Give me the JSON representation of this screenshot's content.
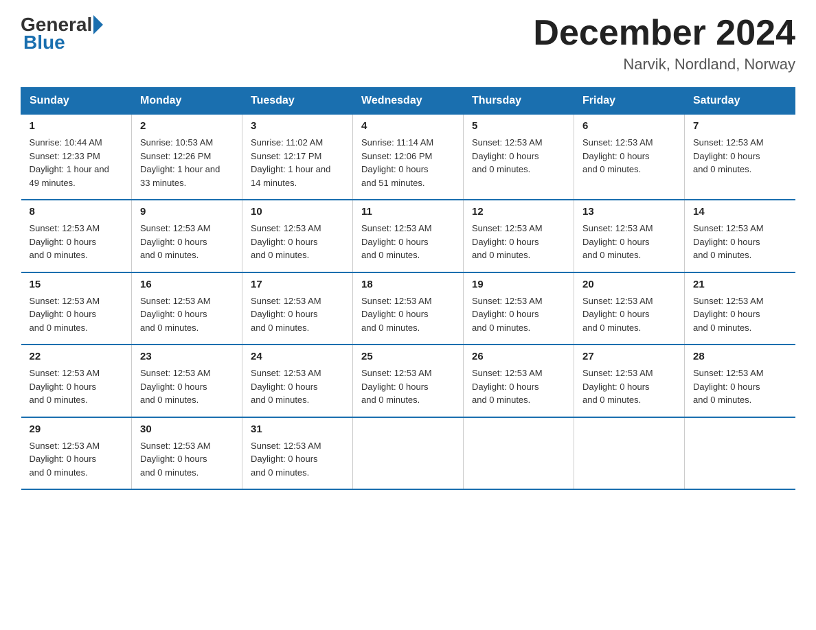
{
  "header": {
    "logo_general": "General",
    "logo_blue": "Blue",
    "month_title": "December 2024",
    "location": "Narvik, Nordland, Norway"
  },
  "days_of_week": [
    "Sunday",
    "Monday",
    "Tuesday",
    "Wednesday",
    "Thursday",
    "Friday",
    "Saturday"
  ],
  "weeks": [
    [
      {
        "day": "1",
        "info": "Sunrise: 10:44 AM\nSunset: 12:33 PM\nDaylight: 1 hour and\n49 minutes."
      },
      {
        "day": "2",
        "info": "Sunrise: 10:53 AM\nSunset: 12:26 PM\nDaylight: 1 hour and\n33 minutes."
      },
      {
        "day": "3",
        "info": "Sunrise: 11:02 AM\nSunset: 12:17 PM\nDaylight: 1 hour and\n14 minutes."
      },
      {
        "day": "4",
        "info": "Sunrise: 11:14 AM\nSunset: 12:06 PM\nDaylight: 0 hours\nand 51 minutes."
      },
      {
        "day": "5",
        "info": "Sunset: 12:53 AM\nDaylight: 0 hours\nand 0 minutes."
      },
      {
        "day": "6",
        "info": "Sunset: 12:53 AM\nDaylight: 0 hours\nand 0 minutes."
      },
      {
        "day": "7",
        "info": "Sunset: 12:53 AM\nDaylight: 0 hours\nand 0 minutes."
      }
    ],
    [
      {
        "day": "8",
        "info": "Sunset: 12:53 AM\nDaylight: 0 hours\nand 0 minutes."
      },
      {
        "day": "9",
        "info": "Sunset: 12:53 AM\nDaylight: 0 hours\nand 0 minutes."
      },
      {
        "day": "10",
        "info": "Sunset: 12:53 AM\nDaylight: 0 hours\nand 0 minutes."
      },
      {
        "day": "11",
        "info": "Sunset: 12:53 AM\nDaylight: 0 hours\nand 0 minutes."
      },
      {
        "day": "12",
        "info": "Sunset: 12:53 AM\nDaylight: 0 hours\nand 0 minutes."
      },
      {
        "day": "13",
        "info": "Sunset: 12:53 AM\nDaylight: 0 hours\nand 0 minutes."
      },
      {
        "day": "14",
        "info": "Sunset: 12:53 AM\nDaylight: 0 hours\nand 0 minutes."
      }
    ],
    [
      {
        "day": "15",
        "info": "Sunset: 12:53 AM\nDaylight: 0 hours\nand 0 minutes."
      },
      {
        "day": "16",
        "info": "Sunset: 12:53 AM\nDaylight: 0 hours\nand 0 minutes."
      },
      {
        "day": "17",
        "info": "Sunset: 12:53 AM\nDaylight: 0 hours\nand 0 minutes."
      },
      {
        "day": "18",
        "info": "Sunset: 12:53 AM\nDaylight: 0 hours\nand 0 minutes."
      },
      {
        "day": "19",
        "info": "Sunset: 12:53 AM\nDaylight: 0 hours\nand 0 minutes."
      },
      {
        "day": "20",
        "info": "Sunset: 12:53 AM\nDaylight: 0 hours\nand 0 minutes."
      },
      {
        "day": "21",
        "info": "Sunset: 12:53 AM\nDaylight: 0 hours\nand 0 minutes."
      }
    ],
    [
      {
        "day": "22",
        "info": "Sunset: 12:53 AM\nDaylight: 0 hours\nand 0 minutes."
      },
      {
        "day": "23",
        "info": "Sunset: 12:53 AM\nDaylight: 0 hours\nand 0 minutes."
      },
      {
        "day": "24",
        "info": "Sunset: 12:53 AM\nDaylight: 0 hours\nand 0 minutes."
      },
      {
        "day": "25",
        "info": "Sunset: 12:53 AM\nDaylight: 0 hours\nand 0 minutes."
      },
      {
        "day": "26",
        "info": "Sunset: 12:53 AM\nDaylight: 0 hours\nand 0 minutes."
      },
      {
        "day": "27",
        "info": "Sunset: 12:53 AM\nDaylight: 0 hours\nand 0 minutes."
      },
      {
        "day": "28",
        "info": "Sunset: 12:53 AM\nDaylight: 0 hours\nand 0 minutes."
      }
    ],
    [
      {
        "day": "29",
        "info": "Sunset: 12:53 AM\nDaylight: 0 hours\nand 0 minutes."
      },
      {
        "day": "30",
        "info": "Sunset: 12:53 AM\nDaylight: 0 hours\nand 0 minutes."
      },
      {
        "day": "31",
        "info": "Sunset: 12:53 AM\nDaylight: 0 hours\nand 0 minutes."
      },
      {
        "day": "",
        "info": ""
      },
      {
        "day": "",
        "info": ""
      },
      {
        "day": "",
        "info": ""
      },
      {
        "day": "",
        "info": ""
      }
    ]
  ]
}
